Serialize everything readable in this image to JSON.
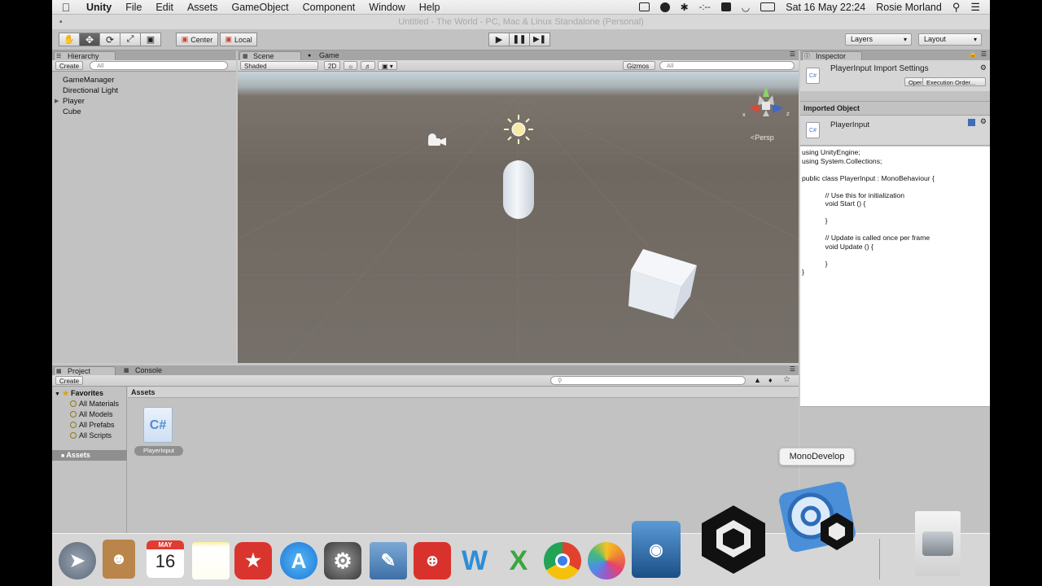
{
  "menubar": {
    "app": "Unity",
    "items": [
      "File",
      "Edit",
      "Assets",
      "GameObject",
      "Component",
      "Window",
      "Help"
    ],
    "status_dash": "-:--",
    "datetime": "Sat 16 May  22:24",
    "user": "Rosie Morland"
  },
  "window": {
    "title": "Untitled - The World - PC, Mac & Linux Standalone (Personal)"
  },
  "toolbar": {
    "pivot": "Center",
    "space": "Local",
    "layers": "Layers",
    "layout": "Layout"
  },
  "hierarchy": {
    "tab": "Hierarchy",
    "create": "Create",
    "search_placeholder": "All",
    "items": [
      "GameManager",
      "Directional Light",
      "Player",
      "Cube"
    ]
  },
  "scene": {
    "tab_scene": "Scene",
    "tab_game": "Game",
    "shading": "Shaded",
    "mode_2d": "2D",
    "gizmos": "Gizmos",
    "search_placeholder": "All",
    "persp": "Persp",
    "axis_x": "x",
    "axis_z": "z"
  },
  "inspector": {
    "tab": "Inspector",
    "title": "PlayerInput Import Settings",
    "open": "Open...",
    "execution_order": "Execution Order...",
    "imported_object": "Imported Object",
    "object_name": "PlayerInput",
    "code": "using UnityEngine;\nusing System.Collections;\n\npublic class PlayerInput : MonoBehaviour {\n\n\t\t// Use this for initialization\n\t\tvoid Start () {\n\t\t\n\t\t}\n\t\t\n\t\t// Update is called once per frame\n\t\tvoid Update () {\n\t\t\n\t\t}\n}"
  },
  "project": {
    "tab_project": "Project",
    "tab_console": "Console",
    "create": "Create",
    "favorites": "Favorites",
    "favorite_items": [
      "All Materials",
      "All Models",
      "All Prefabs",
      "All Scripts"
    ],
    "assets_folder": "Assets",
    "breadcrumb": "Assets",
    "asset_name": "PlayerInput",
    "asset_icon_text": "C#"
  },
  "dock": {
    "tooltip": "MonoDevelop",
    "calendar_month": "MAY",
    "calendar_day": "16"
  },
  "colors": {
    "unity_panel": "#c2c2c2",
    "scene_ground": "#6f6860",
    "selection_blue": "#3d7bc7"
  }
}
